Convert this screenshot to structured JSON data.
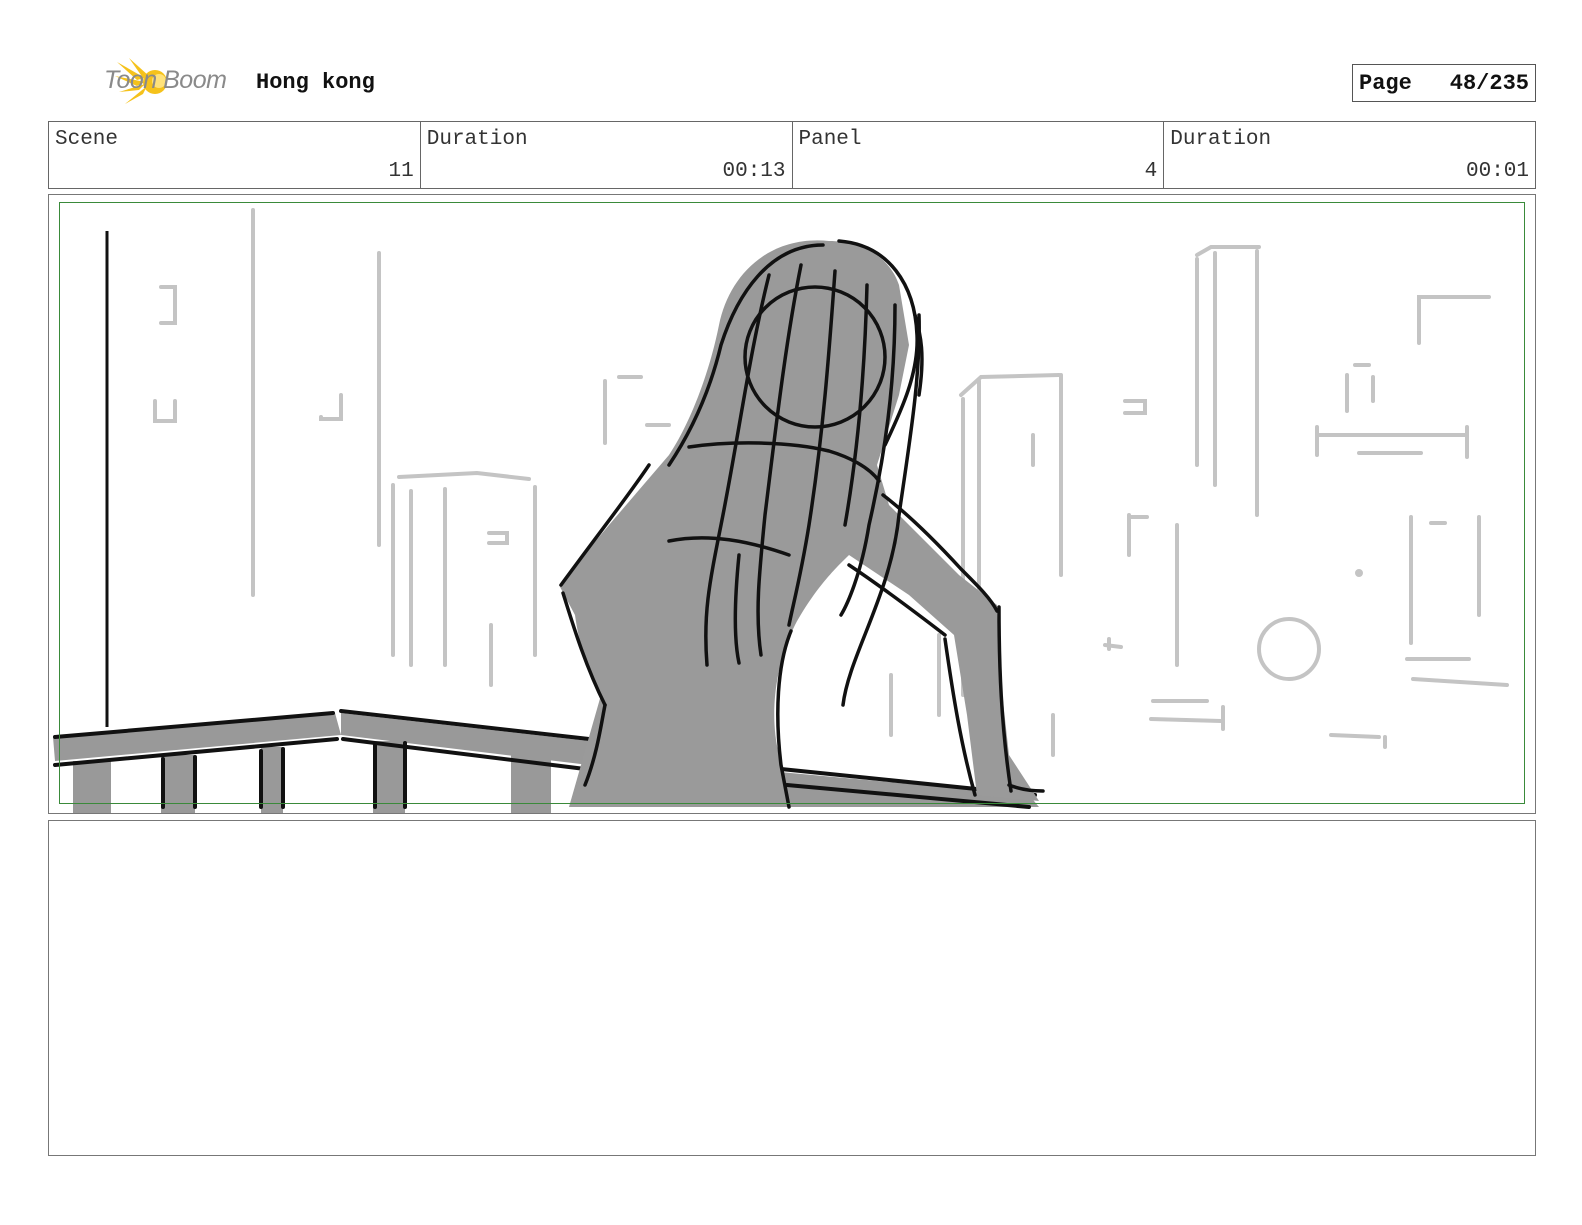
{
  "header": {
    "logo_text": "Toon Boom",
    "project_title": "Hong kong",
    "page_label": "Page",
    "page_number": "48/235"
  },
  "info": {
    "scene_label": "Scene",
    "scene_value": "11",
    "scene_duration_label": "Duration",
    "scene_duration_value": "00:13",
    "panel_label": "Panel",
    "panel_value": "4",
    "panel_duration_label": "Duration",
    "panel_duration_value": "00:01"
  },
  "colors": {
    "safe_frame": "#3a8a3a",
    "logo_yellow": "#f5c21b",
    "sketch_fill": "#999999"
  },
  "notes": {
    "text": ""
  }
}
